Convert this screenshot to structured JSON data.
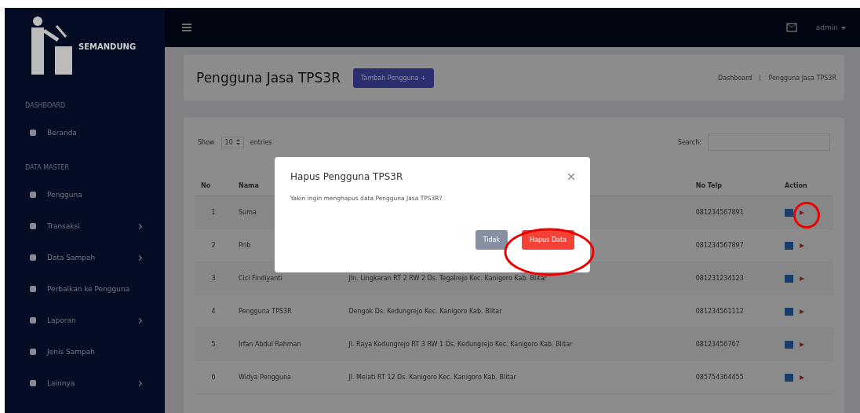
{
  "brand": {
    "name": "SEMANDUNG"
  },
  "topbar": {
    "user": "admin"
  },
  "sidebar": {
    "sections": [
      {
        "heading": "DASHBOARD",
        "items": [
          {
            "label": "Beranda",
            "has_submenu": false
          }
        ]
      },
      {
        "heading": "DATA MASTER",
        "items": [
          {
            "label": "Pengguna",
            "has_submenu": false
          },
          {
            "label": "Transaksi",
            "has_submenu": true
          },
          {
            "label": "Data Sampah",
            "has_submenu": true
          },
          {
            "label": "Perbaikan ke Pengguna",
            "has_submenu": false
          },
          {
            "label": "Laporan",
            "has_submenu": true
          },
          {
            "label": "Jenis Sampah",
            "has_submenu": false
          },
          {
            "label": "Lainnya",
            "has_submenu": true
          }
        ]
      }
    ]
  },
  "page": {
    "title": "Pengguna Jasa TPS3R",
    "add_button": "Tambah Pengguna +",
    "breadcrumb": [
      "Dashboard",
      "Pengguna Jasa TPS3R"
    ]
  },
  "table_controls": {
    "show_label": "Show",
    "entries_value": "10",
    "entries_label": "entries",
    "search_label": "Search:"
  },
  "table": {
    "columns": [
      "No",
      "Nama",
      "No Telp",
      "Action"
    ],
    "rows": [
      {
        "no": "1",
        "name": "Suma",
        "phone": "081234567891"
      },
      {
        "no": "2",
        "name": "Prib",
        "phone": "081234567897"
      },
      {
        "no": "3",
        "name": "Cici Findiyanti",
        "address": "Jln. Lingkaran RT 2 RW 2 Ds. Tegalrejo Kec. Kanigoro Kab. Blitar",
        "phone": "081231234123"
      },
      {
        "no": "4",
        "name": "Pengguna TPS3R",
        "address": "Dengok Ds. Kedungrejo Kec. Kanigoro Kab. Blitar",
        "phone": "081234561112"
      },
      {
        "no": "5",
        "name": "Irfan Abdul Rahman",
        "address": "Jl. Raya Kedungrejo RT 3 RW 1 Ds. Kedungrejo Kec. Kanigoro Kab. Blitar",
        "phone": "08123456767"
      },
      {
        "no": "6",
        "name": "Widya Pengguna",
        "address": "Jl. Melati RT 12 Ds. Kanigoro Kec. Kanigoro Kab. Blitar",
        "phone": "085754364455"
      }
    ]
  },
  "modal": {
    "title": "Hapus Pengguna TPS3R",
    "message": "Yakin ingin menghapus data Pengguna Jasa TPS3R?",
    "buttons": [
      {
        "label": "Tidak",
        "kind": "cancel"
      },
      {
        "label": "Hapus Data",
        "kind": "danger"
      }
    ]
  }
}
